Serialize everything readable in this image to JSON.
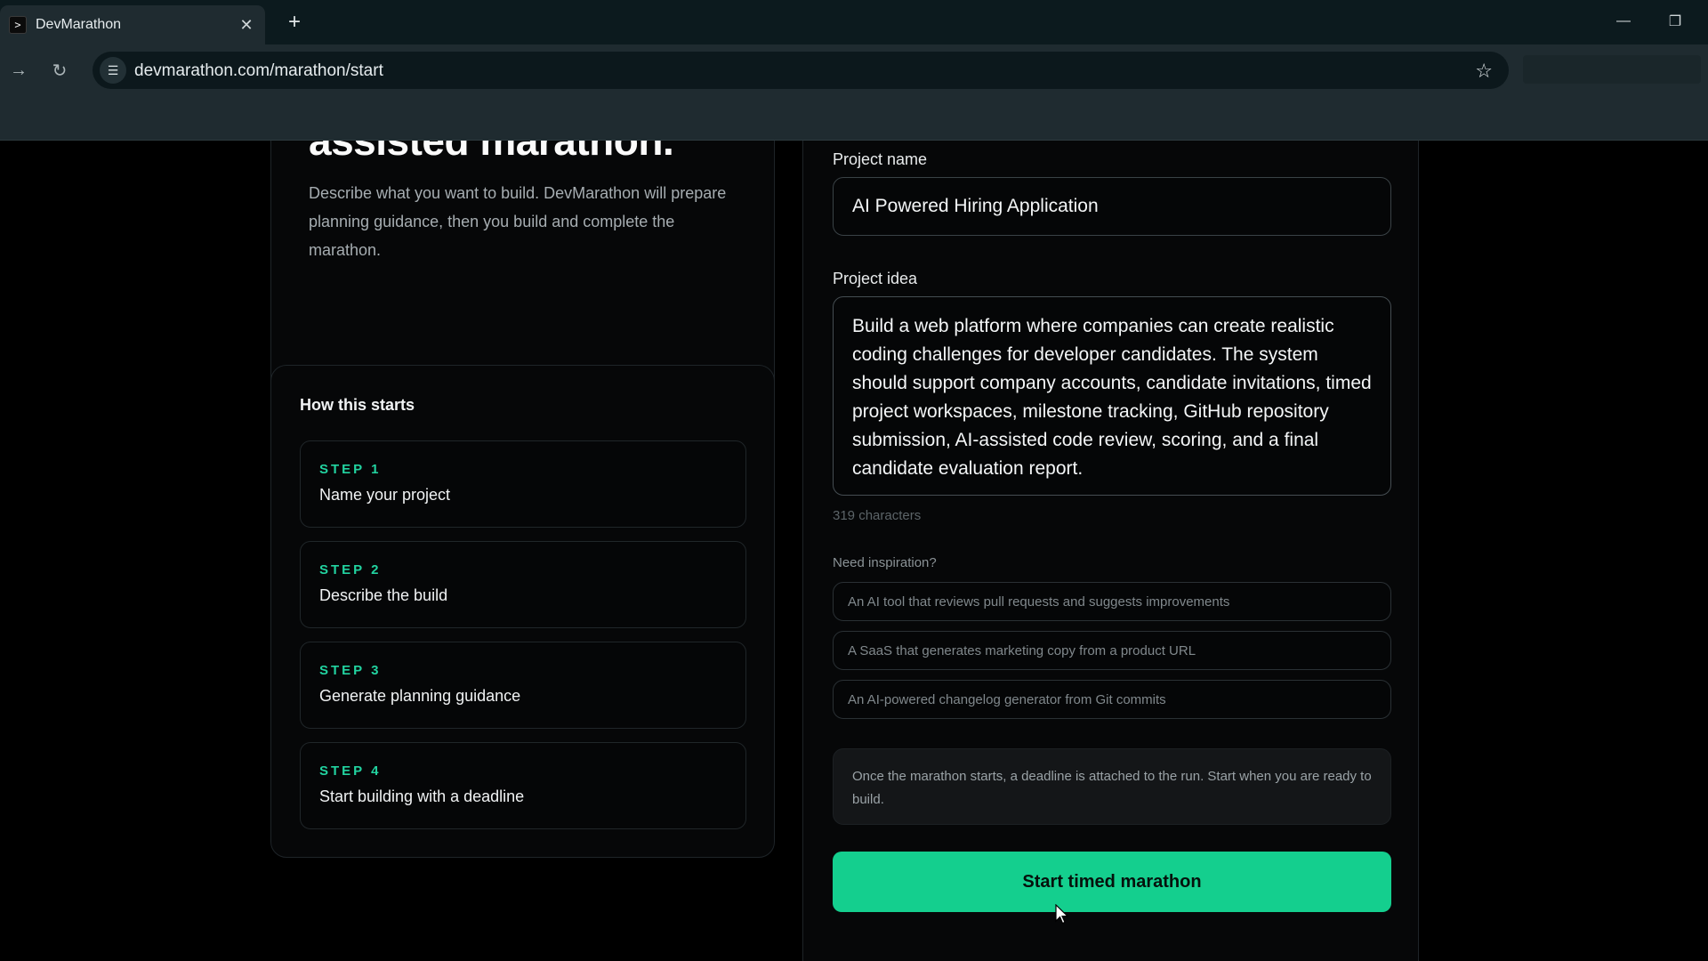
{
  "browser": {
    "tab_title": "DevMarathon",
    "tab_favicon": ">",
    "url": "devmarathon.com/marathon/start"
  },
  "hero": {
    "title": "assisted marathon.",
    "description": "Describe what you want to build. DevMarathon will prepare planning guidance, then you build and complete the marathon."
  },
  "how_it_starts": {
    "title": "How this starts",
    "steps": [
      {
        "label": "STEP 1",
        "text": "Name your project"
      },
      {
        "label": "STEP 2",
        "text": "Describe the build"
      },
      {
        "label": "STEP 3",
        "text": "Generate planning guidance"
      },
      {
        "label": "STEP 4",
        "text": "Start building with a deadline"
      }
    ]
  },
  "form": {
    "project_name_label": "Project name",
    "project_name_value": "AI Powered Hiring Application",
    "project_idea_label": "Project idea",
    "project_idea_value": "Build a web platform where companies can create realistic coding challenges for developer candidates. The system should support company accounts, candidate invitations, timed project workspaces, milestone tracking, GitHub repository submission, AI-assisted code review, scoring, and a final candidate evaluation report.",
    "char_count": "319 characters",
    "inspiration_label": "Need inspiration?",
    "inspirations": [
      "An AI tool that reviews pull requests and suggests improvements",
      "A SaaS that generates marketing copy from a product URL",
      "An AI-powered changelog generator from Git commits"
    ],
    "notice": "Once the marathon starts, a deadline is attached to the run. Start when you are ready to build.",
    "submit_label": "Start timed marathon"
  },
  "colors": {
    "accent": "#14cf8e",
    "step_label": "#22d3a0",
    "background": "#000000"
  }
}
